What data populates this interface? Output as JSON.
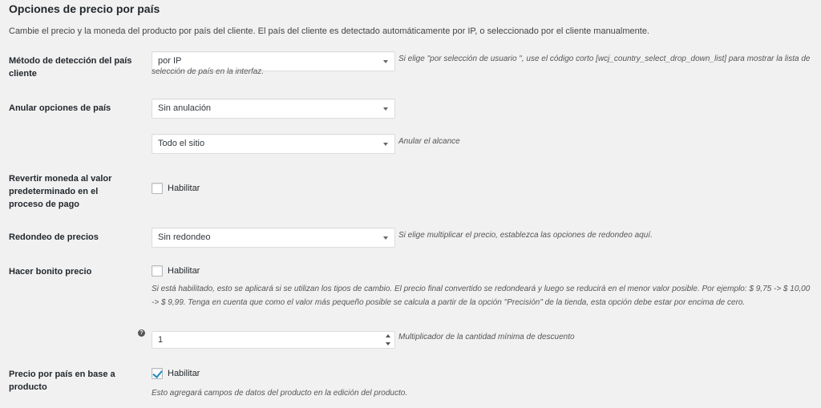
{
  "section": {
    "title": "Opciones de precio por país",
    "description": "Cambie el precio y la moneda del producto por país del cliente. El país del cliente es detectado automáticamente por IP, o seleccionado por el cliente manualmente."
  },
  "detection": {
    "label": "Método de detección del país cliente",
    "value": "por IP",
    "hint": "Si elige \"por selección de usuario \", use el código corto [wcj_country_select_drop_down_list] para mostrar la lista de selección de país en la interfaz."
  },
  "override": {
    "label": "Anular opciones de país",
    "value": "Sin anulación",
    "scope_value": "Todo el sitio",
    "scope_hint": "Anular el alcance"
  },
  "revert": {
    "label": "Revertir moneda al valor predeterminado en el proceso de pago",
    "checkbox_label": "Habilitar",
    "checked": false
  },
  "rounding": {
    "label": "Redondeo de precios",
    "value": "Sin redondeo",
    "hint": "Si elige multiplicar el precio, establezca las opciones de redondeo aquí."
  },
  "pretty_price": {
    "label": "Hacer bonito precio",
    "checkbox_label": "Habilitar",
    "checked": false,
    "hint": "Si está habilitado, esto se aplicará si se utilizan los tipos de cambio. El precio final convertido se redondeará y luego se reducirá en el menor valor posible. Por ejemplo: $ 9,75 -> $ 10,00 -> $ 9,99. Tenga en cuenta que como el valor más pequeño posible se calcula a partir de la opción \"Precisión\" de la tienda, esta opción debe estar por encima de cero.",
    "multiplier_value": "1",
    "multiplier_hint": "Multiplicador de la cantidad mínima de descuento",
    "help_glyph": "?"
  },
  "per_product": {
    "label": "Precio por país en base a producto",
    "checkbox_label": "Habilitar",
    "checked": true,
    "hint": "Esto agregará campos de datos del producto en la edición del producto."
  },
  "icons": {
    "select_caret": "caret-down-icon",
    "help": "help-icon",
    "spinner": "spinner-arrows-icon"
  }
}
